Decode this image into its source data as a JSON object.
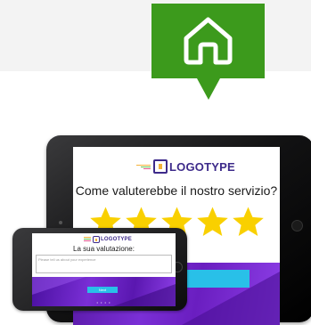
{
  "colors": {
    "pin_green": "#3c9a1c",
    "brand_purple": "#3d2a8a",
    "button_cyan": "#29c0e8",
    "star_yellow": "#f9d000",
    "footer_purple": "#7a2fd6"
  },
  "location_pin": {
    "icon": "home-icon"
  },
  "tablet": {
    "logo_text": "LOGOTYPE",
    "question": "Come valuterebbe il nostro servizio?",
    "stars": [
      {
        "icon": "star-icon"
      },
      {
        "icon": "star-icon"
      },
      {
        "icon": "star-icon"
      },
      {
        "icon": "star-icon"
      },
      {
        "icon": "star-icon"
      }
    ]
  },
  "phone": {
    "logo_text": "LOGOTYPE",
    "label": "La sua valutazione:",
    "input_placeholder": "Please tell us about your experience",
    "button_label": "Next",
    "pager": "• • • •"
  }
}
